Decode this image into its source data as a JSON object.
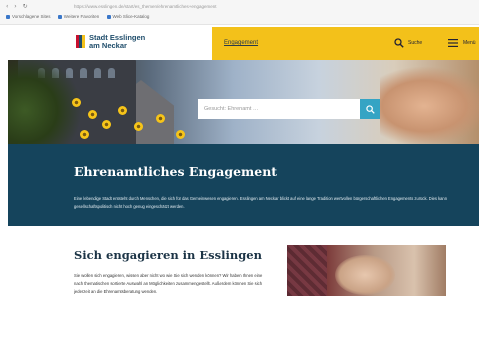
{
  "browser": {
    "nav_glyphs": "‹ › ↻",
    "url": "https://www.esslingen.de/start/es_themen/ehrenamtliches+engagement",
    "bookmarks": [
      "Vorschlagene Sites",
      "Weitere Favoriten",
      "Web Slice-Katalog"
    ]
  },
  "header": {
    "logo_line1": "Stadt Esslingen",
    "logo_line2": "am Neckar",
    "nav_label": "Engagement",
    "search_label": "Suche",
    "menu_label": "Menü"
  },
  "hero": {
    "search_placeholder": "Gesucht: Ehrenamt …"
  },
  "band": {
    "title": "Ehrenamtliches Engagement",
    "text": "Eine lebendige Stadt entsteht durch Menschen, die sich für das Gemeinwesen engagieren. Esslingen am Neckar blickt auf eine lange Tradition wertvollen bürgerschaftlichen Engagements zurück. Dies kann gesellschaftspolitisch nicht hoch genug eingeschätzt werden."
  },
  "section": {
    "title": "Sich engagieren in Esslingen",
    "text": "Sie wollen sich engagieren, wissen aber nicht wo wie Sie sich wenden können? Wir haben Ihnen eine nach thematischen sortierte Auswahl an Möglichkeiten zusammengestellt. Außerdem können Sie sich jederzeit an die Ehrenamtsberatung wenden."
  },
  "colors": {
    "accent_yellow": "#f3c11a",
    "band_teal": "#15445c",
    "search_button": "#35a4c4"
  }
}
